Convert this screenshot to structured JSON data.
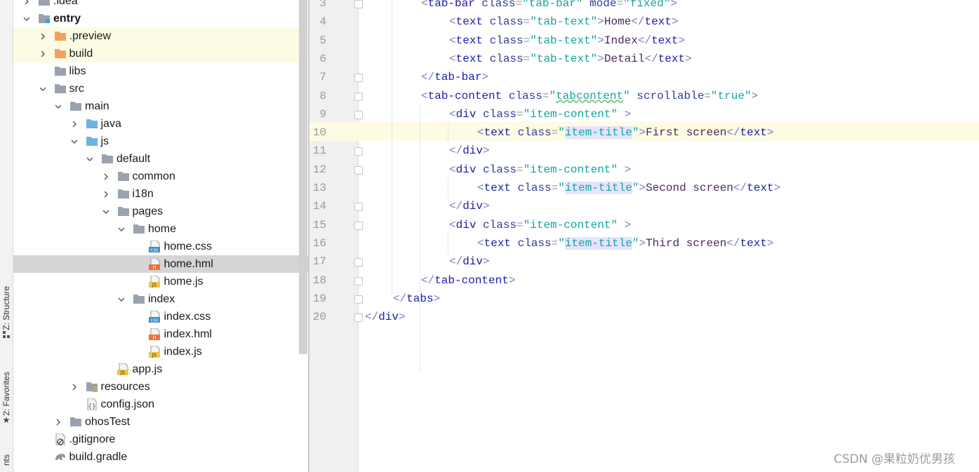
{
  "side_tools": {
    "structure_label": "Z: Structure",
    "favorites_label": "2: Favorites",
    "partial_label": "nts"
  },
  "tree": [
    {
      "label": ".idea",
      "indent": 2,
      "expanded": false,
      "icon": "folder-icon",
      "icon_text": ""
    },
    {
      "label": "entry",
      "indent": 2,
      "expanded": true,
      "icon": "module-folder-icon",
      "bold": true,
      "icon_text": ""
    },
    {
      "label": ".preview",
      "indent": 3,
      "expanded": false,
      "icon": "excluded-folder-icon",
      "highlight": true,
      "icon_text": ""
    },
    {
      "label": "build",
      "indent": 3,
      "expanded": false,
      "icon": "excluded-folder-icon",
      "highlight": true,
      "icon_text": ""
    },
    {
      "label": "libs",
      "indent": 3,
      "icon": "folder-icon",
      "icon_text": ""
    },
    {
      "label": "src",
      "indent": 3,
      "expanded": true,
      "icon": "folder-icon",
      "icon_text": ""
    },
    {
      "label": "main",
      "indent": 4,
      "expanded": true,
      "icon": "folder-icon",
      "icon_text": ""
    },
    {
      "label": "java",
      "indent": 5,
      "expanded": false,
      "icon": "source-folder-icon",
      "icon_text": ""
    },
    {
      "label": "js",
      "indent": 5,
      "expanded": true,
      "icon": "source-folder-icon",
      "icon_text": ""
    },
    {
      "label": "default",
      "indent": 6,
      "expanded": true,
      "icon": "folder-icon",
      "icon_text": ""
    },
    {
      "label": "common",
      "indent": 7,
      "expanded": false,
      "icon": "folder-icon",
      "icon_text": ""
    },
    {
      "label": "i18n",
      "indent": 7,
      "expanded": false,
      "icon": "folder-icon",
      "icon_text": ""
    },
    {
      "label": "pages",
      "indent": 7,
      "expanded": true,
      "icon": "folder-icon",
      "icon_text": ""
    },
    {
      "label": "home",
      "indent": 8,
      "expanded": true,
      "icon": "folder-icon",
      "icon_text": ""
    },
    {
      "label": "home.css",
      "indent": 9,
      "icon": "css-file-icon",
      "icon_text": "css"
    },
    {
      "label": "home.hml",
      "indent": 9,
      "icon": "hml-file-icon",
      "selected": true,
      "icon_text": "H"
    },
    {
      "label": "home.js",
      "indent": 9,
      "icon": "js-file-icon",
      "icon_text": "JS"
    },
    {
      "label": "index",
      "indent": 8,
      "expanded": true,
      "icon": "folder-icon",
      "icon_text": ""
    },
    {
      "label": "index.css",
      "indent": 9,
      "icon": "css-file-icon",
      "icon_text": "css"
    },
    {
      "label": "index.hml",
      "indent": 9,
      "icon": "hml-file-icon",
      "icon_text": "H"
    },
    {
      "label": "index.js",
      "indent": 9,
      "icon": "js-file-icon",
      "icon_text": "JS"
    },
    {
      "label": "app.js",
      "indent": 7,
      "icon": "js-file-icon",
      "icon_text": "JS"
    },
    {
      "label": "resources",
      "indent": 5,
      "expanded": false,
      "icon": "resources-folder-icon",
      "icon_text": ""
    },
    {
      "label": "config.json",
      "indent": 5,
      "icon": "json-file-icon",
      "icon_text": "{}"
    },
    {
      "label": "ohosTest",
      "indent": 4,
      "expanded": false,
      "icon": "folder-icon",
      "icon_text": ""
    },
    {
      "label": ".gitignore",
      "indent": 3,
      "icon": "gitignore-file-icon",
      "icon_text": ""
    },
    {
      "label": "build.gradle",
      "indent": 3,
      "icon": "gradle-file-icon",
      "icon_text": ""
    }
  ],
  "editor": {
    "current_line": 10,
    "lines": [
      {
        "n": "3",
        "tokens": [
          [
            "<",
            "br"
          ],
          [
            "tab-bar",
            "tag"
          ],
          [
            " class",
            "at"
          ],
          [
            "=",
            "eq"
          ],
          [
            "\"tab-bar\"",
            "val"
          ],
          [
            " mode",
            "at"
          ],
          [
            "=",
            "eq"
          ],
          [
            "\"fixed\"",
            "val"
          ],
          [
            ">",
            "br"
          ]
        ]
      },
      {
        "n": "4",
        "tokens": [
          [
            "<",
            "br"
          ],
          [
            "text",
            "tag"
          ],
          [
            " class",
            "at"
          ],
          [
            "=",
            "eq"
          ],
          [
            "\"tab-text\"",
            "val"
          ],
          [
            ">",
            "br"
          ],
          [
            "Home",
            "txt"
          ],
          [
            "</",
            "br"
          ],
          [
            "text",
            "tag"
          ],
          [
            ">",
            "br"
          ]
        ]
      },
      {
        "n": "5",
        "tokens": [
          [
            "<",
            "br"
          ],
          [
            "text",
            "tag"
          ],
          [
            " class",
            "at"
          ],
          [
            "=",
            "eq"
          ],
          [
            "\"tab-text\"",
            "val"
          ],
          [
            ">",
            "br"
          ],
          [
            "Index",
            "txt"
          ],
          [
            "</",
            "br"
          ],
          [
            "text",
            "tag"
          ],
          [
            ">",
            "br"
          ]
        ]
      },
      {
        "n": "6",
        "tokens": [
          [
            "<",
            "br"
          ],
          [
            "text",
            "tag"
          ],
          [
            " class",
            "at"
          ],
          [
            "=",
            "eq"
          ],
          [
            "\"tab-text\"",
            "val"
          ],
          [
            ">",
            "br"
          ],
          [
            "Detail",
            "txt"
          ],
          [
            "</",
            "br"
          ],
          [
            "text",
            "tag"
          ],
          [
            ">",
            "br"
          ]
        ]
      },
      {
        "n": "7",
        "tokens": [
          [
            "</",
            "br"
          ],
          [
            "tab-bar",
            "tag"
          ],
          [
            ">",
            "br"
          ]
        ]
      },
      {
        "n": "8",
        "tokens": [
          [
            "<",
            "br"
          ],
          [
            "tab-content",
            "tag"
          ],
          [
            " class",
            "at"
          ],
          [
            "=",
            "eq"
          ],
          [
            "\"",
            "val"
          ],
          [
            "tabcontent",
            "val wavy"
          ],
          [
            "\"",
            "val"
          ],
          [
            " scrollable",
            "at"
          ],
          [
            "=",
            "eq"
          ],
          [
            "\"true\"",
            "val"
          ],
          [
            ">",
            "br"
          ]
        ]
      },
      {
        "n": "9",
        "tokens": [
          [
            "<",
            "br"
          ],
          [
            "div",
            "tag"
          ],
          [
            " class",
            "at"
          ],
          [
            "=",
            "eq"
          ],
          [
            "\"item-content\"",
            "val"
          ],
          [
            " >",
            "br"
          ]
        ]
      },
      {
        "n": "10",
        "tokens": [
          [
            "<",
            "br"
          ],
          [
            "text",
            "tag"
          ],
          [
            " class",
            "at"
          ],
          [
            "=",
            "eq"
          ],
          [
            "\"",
            "val"
          ],
          [
            "item-title",
            "val hl"
          ],
          [
            "\"",
            "val"
          ],
          [
            ">",
            "br"
          ],
          [
            "First screen",
            "txt"
          ],
          [
            "</",
            "br"
          ],
          [
            "text",
            "tag"
          ],
          [
            ">",
            "br"
          ]
        ]
      },
      {
        "n": "11",
        "tokens": [
          [
            "</",
            "br"
          ],
          [
            "div",
            "tag"
          ],
          [
            ">",
            "br"
          ]
        ]
      },
      {
        "n": "12",
        "tokens": [
          [
            "<",
            "br"
          ],
          [
            "div",
            "tag"
          ],
          [
            " class",
            "at"
          ],
          [
            "=",
            "eq"
          ],
          [
            "\"item-content\"",
            "val"
          ],
          [
            " >",
            "br"
          ]
        ]
      },
      {
        "n": "13",
        "tokens": [
          [
            "<",
            "br"
          ],
          [
            "text",
            "tag"
          ],
          [
            " class",
            "at"
          ],
          [
            "=",
            "eq"
          ],
          [
            "\"",
            "val"
          ],
          [
            "item-title",
            "val hl"
          ],
          [
            "\"",
            "val"
          ],
          [
            ">",
            "br"
          ],
          [
            "Second screen",
            "txt"
          ],
          [
            "</",
            "br"
          ],
          [
            "text",
            "tag"
          ],
          [
            ">",
            "br"
          ]
        ]
      },
      {
        "n": "14",
        "tokens": [
          [
            "</",
            "br"
          ],
          [
            "div",
            "tag"
          ],
          [
            ">",
            "br"
          ]
        ]
      },
      {
        "n": "15",
        "tokens": [
          [
            "<",
            "br"
          ],
          [
            "div",
            "tag"
          ],
          [
            " class",
            "at"
          ],
          [
            "=",
            "eq"
          ],
          [
            "\"item-content\"",
            "val"
          ],
          [
            " >",
            "br"
          ]
        ]
      },
      {
        "n": "16",
        "tokens": [
          [
            "<",
            "br"
          ],
          [
            "text",
            "tag"
          ],
          [
            " class",
            "at"
          ],
          [
            "=",
            "eq"
          ],
          [
            "\"",
            "val"
          ],
          [
            "item-title",
            "val hl"
          ],
          [
            "\"",
            "val"
          ],
          [
            ">",
            "br"
          ],
          [
            "Third screen",
            "txt"
          ],
          [
            "</",
            "br"
          ],
          [
            "text",
            "tag"
          ],
          [
            ">",
            "br"
          ]
        ]
      },
      {
        "n": "17",
        "tokens": [
          [
            "</",
            "br"
          ],
          [
            "div",
            "tag"
          ],
          [
            ">",
            "br"
          ]
        ]
      },
      {
        "n": "18",
        "tokens": [
          [
            "</",
            "br"
          ],
          [
            "tab-content",
            "tag"
          ],
          [
            ">",
            "br"
          ]
        ]
      },
      {
        "n": "19",
        "tokens": [
          [
            "</",
            "br"
          ],
          [
            "tabs",
            "tag"
          ],
          [
            ">",
            "br"
          ]
        ]
      },
      {
        "n": "20",
        "tokens": [
          [
            "</",
            "br"
          ],
          [
            "div",
            "tag"
          ],
          [
            ">",
            "br"
          ]
        ]
      }
    ]
  },
  "watermark": "CSDN @果粒奶优男孩"
}
